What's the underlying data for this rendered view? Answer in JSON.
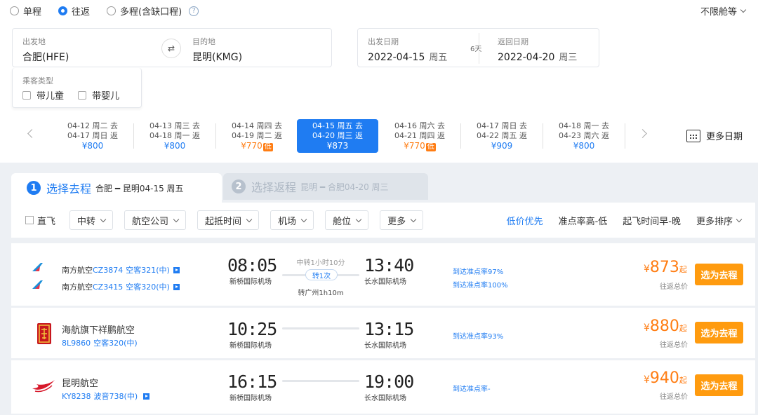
{
  "trip_types": [
    {
      "label": "单程",
      "selected": false
    },
    {
      "label": "往返",
      "selected": true
    },
    {
      "label": "多程(含缺口程)",
      "selected": false
    }
  ],
  "cabin": "不限舱等",
  "search": {
    "from_label": "出发地",
    "from_value": "合肥(HFE)",
    "to_label": "目的地",
    "to_value": "昆明(KMG)",
    "depart_label": "出发日期",
    "depart_date": "2022-04-15",
    "depart_week": "周五",
    "days": "6天",
    "return_label": "返回日期",
    "return_date": "2022-04-20",
    "return_week": "周三"
  },
  "passenger": {
    "label": "乘客类型",
    "child": "带儿童",
    "infant": "带婴儿"
  },
  "date_strip": [
    {
      "l1": "04-12  周二 去",
      "l2": "04-17  周日 返",
      "price": "¥800",
      "low": false
    },
    {
      "l1": "04-13  周三 去",
      "l2": "04-18  周一 返",
      "price": "¥800",
      "low": false
    },
    {
      "l1": "04-14  周四 去",
      "l2": "04-19  周二 返",
      "price": "¥770",
      "low": true
    },
    {
      "l1": "04-15  周五 去",
      "l2": "04-20  周三 返",
      "price": "¥873",
      "low": false,
      "selected": true
    },
    {
      "l1": "04-16  周六 去",
      "l2": "04-21  周四 返",
      "price": "¥770",
      "low": true
    },
    {
      "l1": "04-17  周日 去",
      "l2": "04-22  周五 返",
      "price": "¥909",
      "low": false
    },
    {
      "l1": "04-18  周一 去",
      "l2": "04-23  周六 返",
      "price": "¥800",
      "low": false
    }
  ],
  "low_tag": "低",
  "more_dates": "更多日期",
  "tabs": {
    "t1_num": "1",
    "t1_title": "选择去程",
    "t1_sub": "合肥 ━ 昆明04-15 周五",
    "t2_num": "2",
    "t2_title": "选择返程",
    "t2_sub": "昆明 ━ 合肥04-20 周三"
  },
  "filters": {
    "direct": "直飞",
    "dropdowns": [
      "中转",
      "航空公司",
      "起抵时间",
      "机场",
      "舱位",
      "更多"
    ]
  },
  "sorts": [
    "低价优先",
    "准点率高-低",
    "起飞时间早-晚",
    "更多排序"
  ],
  "flights": [
    {
      "legs": [
        {
          "airline": "南方航空",
          "flight": "CZ3874",
          "plane": "空客321(中)"
        },
        {
          "airline": "南方航空",
          "flight": "CZ3415",
          "plane": "空客320(中)"
        }
      ],
      "dep_time": "08:05",
      "dep_airport": "新桥国际机场",
      "arr_time": "13:40",
      "arr_airport": "长水国际机场",
      "transfer_time": "中转1小时10分",
      "transfer_count": "转1次",
      "transfer_city": "转广州1h10m",
      "ontime": [
        "到达准点率97%",
        "到达准点率100%"
      ],
      "price": "873",
      "price_note": "往返总价",
      "button": "选为去程"
    },
    {
      "legs": [
        {
          "airline": "海航旗下祥鹏航空",
          "flight": "8L9860",
          "plane": "空客320(中)"
        }
      ],
      "dep_time": "10:25",
      "dep_airport": "新桥国际机场",
      "arr_time": "13:15",
      "arr_airport": "长水国际机场",
      "ontime": [
        "到达准点率93%"
      ],
      "price": "880",
      "price_note": "往返总价",
      "button": "选为去程"
    },
    {
      "legs": [
        {
          "airline": "昆明航空",
          "flight": "KY8238",
          "plane": "波音738(中)"
        }
      ],
      "dep_time": "16:15",
      "dep_airport": "新桥国际机场",
      "arr_time": "19:00",
      "arr_airport": "长水国际机场",
      "ontime": [
        "到达准点率-"
      ],
      "price": "940",
      "price_note": "往返总价",
      "button": "选为去程"
    }
  ],
  "price_symbol": "¥",
  "price_suffix": "起"
}
